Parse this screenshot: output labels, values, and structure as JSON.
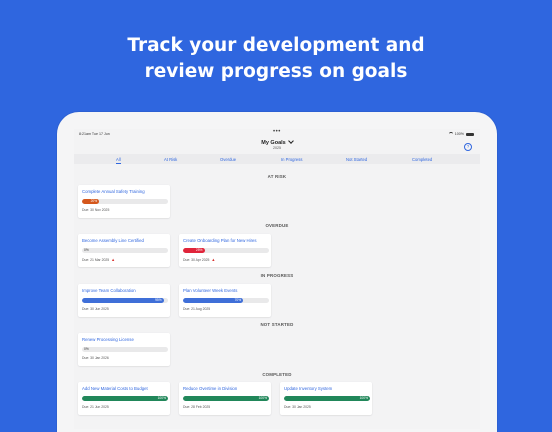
{
  "headline": {
    "line1": "Track your development and",
    "line2": "review progress on goals"
  },
  "status": {
    "time": "8:21am  Tue 17 Jun",
    "dots": "•••",
    "battery": "100%"
  },
  "header": {
    "title": "My Goals",
    "year": "2025",
    "help_icon": "?"
  },
  "tabs": [
    "All",
    "At Risk",
    "Overdue",
    "In Progress",
    "Not Started",
    "Completed"
  ],
  "colors": {
    "accent": "#2f66df",
    "at_risk": "#d4571c",
    "overdue": "#e0243a",
    "in_progress": "#3f6fd8",
    "completed": "#21875a"
  },
  "sections": {
    "at_risk": {
      "label": "AT RISK",
      "goals": [
        {
          "title": "Complete Annual Safety Training",
          "progress": 20,
          "progress_label": "20%",
          "due": "Due: 30 Nov 2025"
        }
      ]
    },
    "overdue": {
      "label": "OVERDUE",
      "goals": [
        {
          "title": "Become Assembly Line Certified",
          "progress": 0,
          "progress_label": "0%",
          "due": "Due: 21 Mar 2025",
          "flag": "▲"
        },
        {
          "title": "Create Onboarding Plan for New Hires",
          "progress": 25,
          "progress_label": "25%",
          "due": "Due: 30 Apr 2025",
          "flag": "▲"
        }
      ]
    },
    "in_progress": {
      "label": "IN PROGRESS",
      "goals": [
        {
          "title": "Improve Team Collaboration",
          "progress": 95,
          "progress_label": "95%",
          "due": "Due: 30 Jun 2025"
        },
        {
          "title": "Plan Volunteer Week Events",
          "progress": 70,
          "progress_label": "70%",
          "due": "Due: 21 Aug 2025"
        }
      ]
    },
    "not_started": {
      "label": "NOT STARTED",
      "goals": [
        {
          "title": "Renew Processing License",
          "progress": 0,
          "progress_label": "0%",
          "due": "Due: 30 Jan 2026"
        }
      ]
    },
    "completed": {
      "label": "COMPLETED",
      "goals": [
        {
          "title": "Add New Material Costs to Budget",
          "progress": 100,
          "progress_label": "100%",
          "due": "Due: 21 Jun 2025"
        },
        {
          "title": "Reduce Overtime in Division",
          "progress": 100,
          "progress_label": "100%",
          "due": "Due: 28 Feb 2025"
        },
        {
          "title": "Update Inventory System",
          "progress": 100,
          "progress_label": "100%",
          "due": "Due: 30 Jan 2025"
        }
      ]
    }
  }
}
